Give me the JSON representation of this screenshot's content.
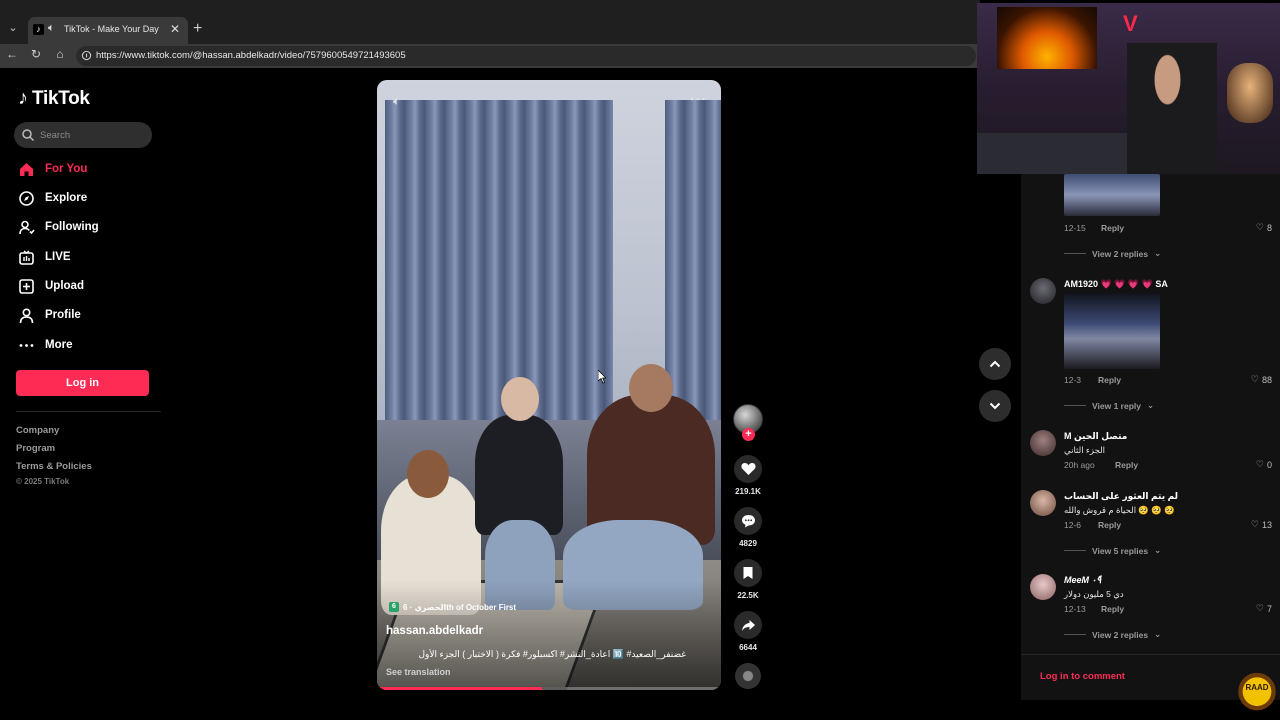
{
  "browser": {
    "tab_title": "TikTok - Make Your Day",
    "tab_close": "✕",
    "new_tab": "+",
    "url": "https://www.tiktok.com/@hassan.abdelkadr/video/7579600549721493605"
  },
  "sidebar": {
    "logo": "TikTok",
    "search_placeholder": "Search",
    "items": [
      {
        "label": "For You",
        "icon": "home-icon",
        "active": true
      },
      {
        "label": "Explore",
        "icon": "compass-icon"
      },
      {
        "label": "Following",
        "icon": "user-follow-icon"
      },
      {
        "label": "LIVE",
        "icon": "live-tv-icon"
      },
      {
        "label": "Upload",
        "icon": "plus-square-icon"
      },
      {
        "label": "Profile",
        "icon": "person-icon"
      },
      {
        "label": "More",
        "icon": "more-dots-icon"
      }
    ],
    "login": "Log in",
    "footer": [
      "Company",
      "Program",
      "Terms & Policies"
    ],
    "copyright": "© 2025 TikTok"
  },
  "video": {
    "song": "الحصري · 6th of October First",
    "song_badge": "6",
    "author": "hassan.abdelkadr",
    "caption": "غضنفر_الصعيد# 🔟 اعادة_النشر# اكسبلور# فكرة ( الاختبار ) الجزء الأول",
    "see_translation": "See translation",
    "progress": 0.48
  },
  "actions": {
    "likes": "219.1K",
    "comments": "4829",
    "saves": "22.5K",
    "shares": "6644"
  },
  "comments": [
    {
      "date": "12-15",
      "reply": "Reply",
      "likes": "8",
      "view_replies": "View 2 replies"
    },
    {
      "name": "AM1920 💗 💗 💗 💗 SA",
      "date": "12-3",
      "reply": "Reply",
      "likes": "88",
      "view_replies": "View 1 reply"
    },
    {
      "name": "M متصل الحين",
      "text": "الجزء الثاني",
      "date": "20h ago",
      "reply": "Reply",
      "likes": "0"
    },
    {
      "name": "لم يتم العثور على الحساب",
      "text": "الحياة م قروش والله 🥺 🥺 🥺",
      "date": "12-6",
      "reply": "Reply",
      "likes": "13",
      "view_replies": "View 5 replies"
    },
    {
      "name": "MeeM ٠ً٩",
      "text": "دي 5 مليون دولار",
      "date": "12-13",
      "reply": "Reply",
      "likes": "7",
      "view_replies": "View 2 replies"
    }
  ],
  "login_to_comment": "Log in to comment",
  "overlay": {
    "badge": "RAAD"
  },
  "colors": {
    "accent": "#fe2c55",
    "background": "#000000",
    "panel": "#121212"
  }
}
